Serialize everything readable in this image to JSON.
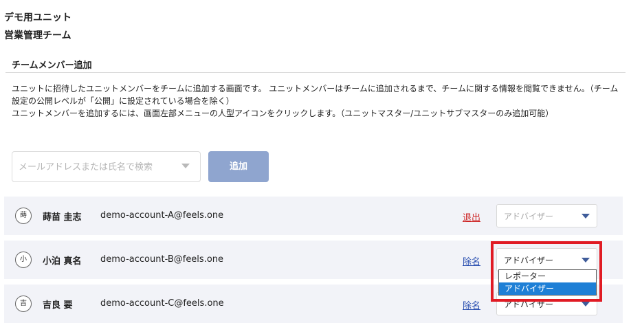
{
  "unit_name": "デモ用ユニット",
  "team_name": "営業管理チーム",
  "section_title": "チームメンバー追加",
  "description": [
    "ユニットに招待したユニットメンバーをチームに追加する画面です。 ユニットメンバーはチームに追加されるまで、チームに関する情報を閲覧できません。（チーム設定の公開レベルが「公開」に設定されている場合を除く）",
    "ユニットメンバーを追加するには、画面左部メニューの人型アイコンをクリックします。（ユニットマスター/ユニットサブマスターのみ追加可能）"
  ],
  "search": {
    "placeholder": "メールアドレスまたは氏名で検索",
    "value": ""
  },
  "add_button_label": "追加",
  "members": [
    {
      "avatar": "蒔",
      "name": "蒔苗 圭志",
      "email": "demo-account-A@feels.one",
      "action": "退出",
      "role": "アドバイザー"
    },
    {
      "avatar": "小",
      "name": "小泊 真名",
      "email": "demo-account-B@feels.one",
      "action": "除名",
      "role": "アドバイザー"
    },
    {
      "avatar": "吉",
      "name": "吉良 要",
      "email": "demo-account-C@feels.one",
      "action": "除名",
      "role": "アドバイザー"
    }
  ],
  "role_options": [
    "レポーター",
    "アドバイザー"
  ],
  "colors": {
    "add_button": "#8fa5cf",
    "leave_link": "#cc1f1f",
    "remove_link": "#2a4fb0",
    "highlight": "#e01b24",
    "selected_option": "#1e7fd6",
    "row_background": "#f2f3f8"
  }
}
